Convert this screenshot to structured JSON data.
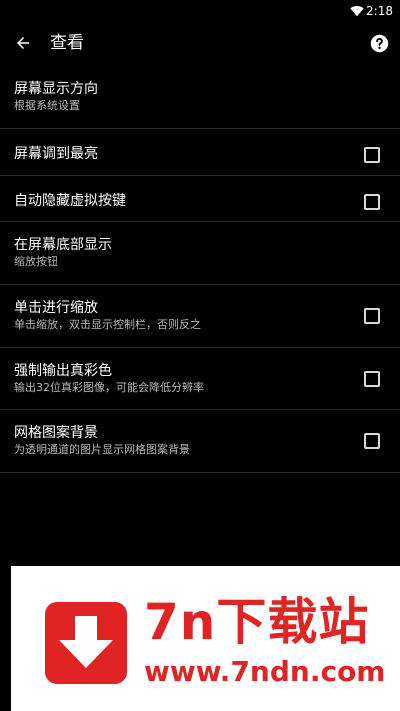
{
  "status_bar": {
    "time": "2:18",
    "wifi_icon": "wifi-icon"
  },
  "app_bar": {
    "title": "查看",
    "back_icon": "arrow-back-icon",
    "help_icon": "help-circle-icon"
  },
  "settings": [
    {
      "label": "屏幕显示方向",
      "summary": "根据系统设置",
      "has_checkbox": false
    },
    {
      "label": "屏幕调到最亮",
      "summary": "",
      "has_checkbox": true,
      "checked": false
    },
    {
      "label": "自动隐藏虚拟按键",
      "summary": "",
      "has_checkbox": true,
      "checked": false
    },
    {
      "label": "在屏幕底部显示",
      "summary": "缩放按钮",
      "has_checkbox": false
    },
    {
      "label": "单击进行缩放",
      "summary": "单击缩放，双击显示控制栏，否则反之",
      "has_checkbox": true,
      "checked": false
    },
    {
      "label": "强制输出真彩色",
      "summary": "输出32位真彩图像，可能会降低分辨率",
      "has_checkbox": true,
      "checked": false
    },
    {
      "label": "网格图案背景",
      "summary": "为透明通道的图片显示网格图案背景",
      "has_checkbox": true,
      "checked": false
    }
  ],
  "watermark": {
    "title": "7n下载站",
    "url": "www.7ndn.com",
    "logo_icon": "download-arrow-icon",
    "color": "#e02424"
  }
}
